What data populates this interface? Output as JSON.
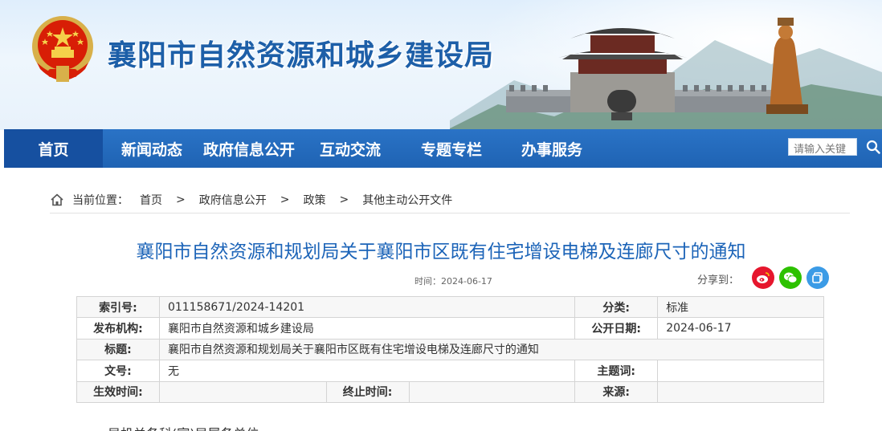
{
  "site": {
    "title": "襄阳市自然资源和城乡建设局"
  },
  "nav": {
    "items": [
      {
        "label": "首页",
        "active": true
      },
      {
        "label": "新闻动态"
      },
      {
        "label": "政府信息公开"
      },
      {
        "label": "互动交流"
      },
      {
        "label": "专题专栏"
      },
      {
        "label": "办事服务"
      }
    ],
    "search_placeholder": "请输入关键"
  },
  "breadcrumb": {
    "prefix": "当前位置：",
    "items": [
      "首页",
      "政府信息公开",
      "政策",
      "其他主动公开文件"
    ],
    "separator": ">"
  },
  "article": {
    "title": "襄阳市自然资源和规划局关于襄阳市区既有住宅增设电梯及连廊尺寸的通知",
    "time": "时间：2024-06-17",
    "share_label": "分享到："
  },
  "info_table": {
    "index_label": "索引号:",
    "index_value": "011158671/2024-14201",
    "category_label": "分类:",
    "category_value": "标准",
    "publisher_label": "发布机构:",
    "publisher_value": "襄阳市自然资源和城乡建设局",
    "pubdate_label": "公开日期:",
    "pubdate_value": "2024-06-17",
    "title_label": "标题:",
    "title_value": "襄阳市自然资源和规划局关于襄阳市区既有住宅增设电梯及连廊尺寸的通知",
    "docno_label": "文号:",
    "docno_value": "无",
    "subject_label": "主题词:",
    "subject_value": "",
    "effective_label": "生效时间:",
    "effective_value": "",
    "expire_label": "终止时间:",
    "expire_value": "",
    "source_label": "来源:",
    "source_value": ""
  },
  "body": {
    "first_line": "局机关各科(室)局属各单位:"
  },
  "colors": {
    "brand_blue": "#1d5fa8",
    "nav_blue": "#2a73c6",
    "nav_active": "#1650a0",
    "title_blue": "#1c64b8",
    "weibo_red": "#e6162d",
    "wechat_green": "#2dc100",
    "qzone_blue": "#3b9be6"
  }
}
